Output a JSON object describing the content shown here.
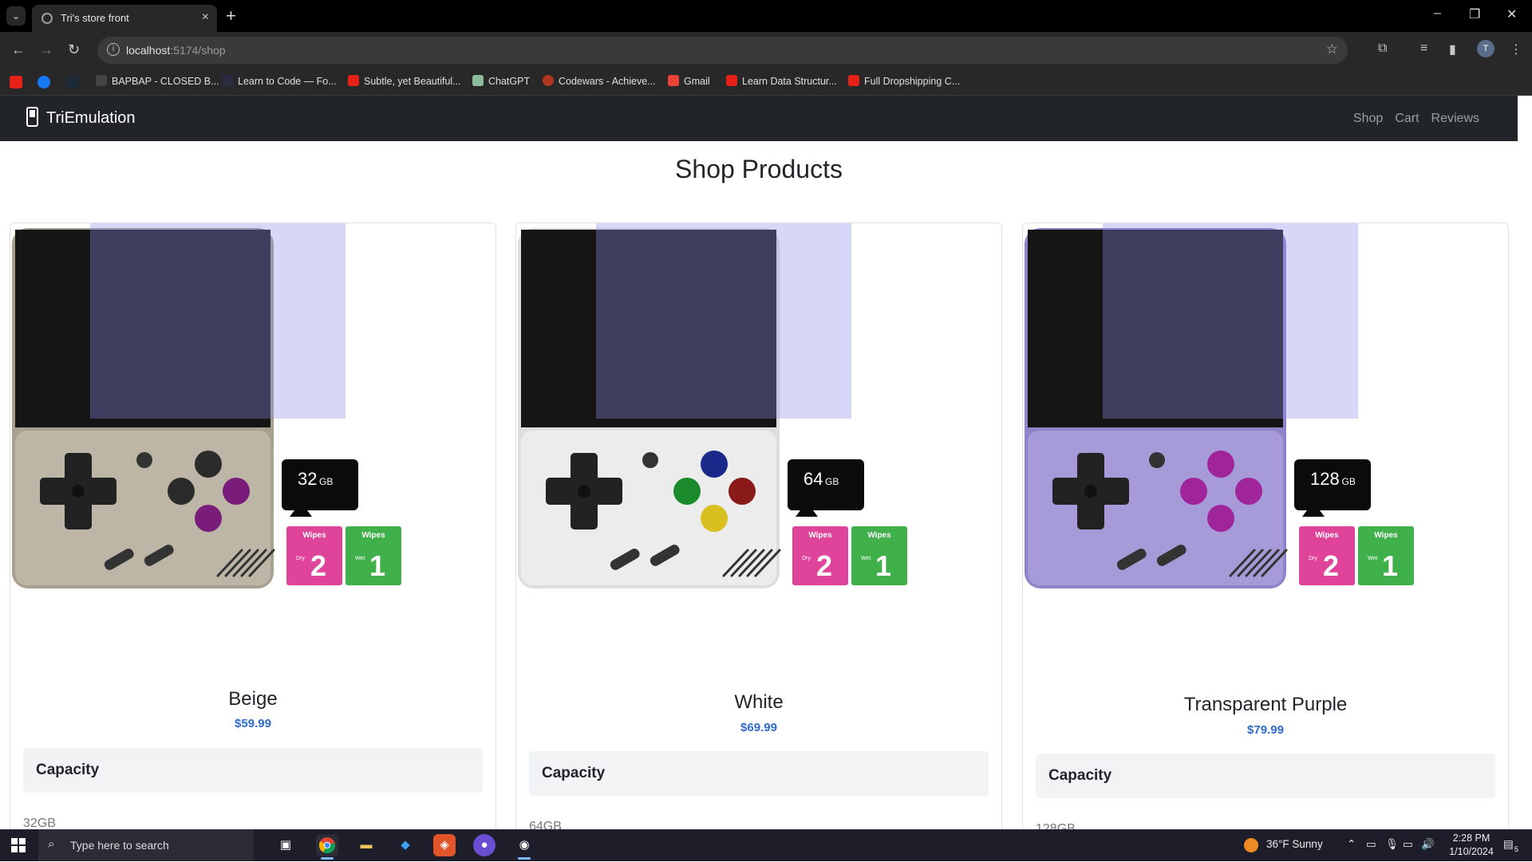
{
  "browser": {
    "tab_title": "Tri's store front",
    "url_host": "localhost",
    "url_rest": ":5174/shop",
    "profile_initial": "T",
    "bookmarks": [
      {
        "label": "BAPBAP - CLOSED B...",
        "color": "#444"
      },
      {
        "label": "Learn to Code — Fo...",
        "color": "#2a2a40"
      },
      {
        "label": "Subtle, yet Beautiful...",
        "color": "#e62117"
      },
      {
        "label": "ChatGPT",
        "color": "#8dbd9d"
      },
      {
        "label": "Codewars - Achieve...",
        "color": "#b1361e"
      },
      {
        "label": "Gmail",
        "color": "#ea4335"
      },
      {
        "label": "Learn Data Structur...",
        "color": "#e62117"
      },
      {
        "label": "Full Dropshipping C...",
        "color": "#e62117"
      }
    ]
  },
  "site": {
    "brand": "TriEmulation",
    "nav": [
      "Shop",
      "Cart",
      "Reviews"
    ],
    "heading": "Shop Products"
  },
  "products": [
    {
      "name": "Beige",
      "price": "$59.99",
      "capacity_label": "Capacity",
      "capacity": "32GB",
      "storage": "32",
      "unit": "GB",
      "body": "#a8a08e",
      "body2": "#bdb6a6",
      "buttons": [
        "#2b2b2b",
        "#2b2b2b",
        "#7a1c7a",
        "#7a1c7a"
      ]
    },
    {
      "name": "White",
      "price": "$69.99",
      "capacity_label": "Capacity",
      "capacity": "64GB",
      "storage": "64",
      "unit": "GB",
      "body": "#dedede",
      "body2": "#ececec",
      "buttons": [
        "#1a2a8a",
        "#1a8a2a",
        "#8a1a1a",
        "#d8c021"
      ]
    },
    {
      "name": "Transparent Purple",
      "price": "$79.99",
      "capacity_label": "Capacity",
      "capacity": "128GB",
      "storage": "128",
      "unit": "GB",
      "body": "#8f84c8",
      "body2": "#a79ad8",
      "buttons": [
        "#a0249a",
        "#a0249a",
        "#a0249a",
        "#a0249a"
      ]
    }
  ],
  "wipes": {
    "title": "Wipes",
    "dry": "Dry",
    "wet": "Wet",
    "n2": "2",
    "n1": "1"
  },
  "taskbar": {
    "search_placeholder": "Type here to search",
    "weather": "36°F  Sunny",
    "time": "2:28 PM",
    "date": "1/10/2024",
    "notif_count": "5"
  }
}
